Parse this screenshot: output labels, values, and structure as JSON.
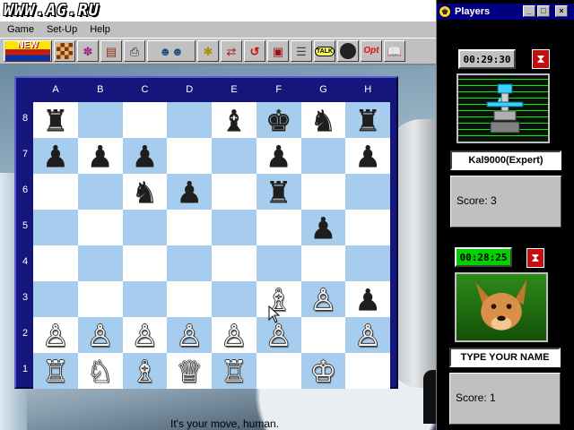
{
  "app": {
    "watermark": "WWW.AG.RU"
  },
  "menu": {
    "items": [
      "Game",
      "Set-Up",
      "Help"
    ]
  },
  "toolbar": {
    "new_label": "NEW",
    "talk_label": "TALK",
    "opt_label": "Opt",
    "buttons": [
      {
        "name": "new-game-button",
        "icon": "sunrise-icon"
      },
      {
        "name": "board-button",
        "icon": "board-icon"
      },
      {
        "name": "brain-button",
        "icon": "brain-icon"
      },
      {
        "name": "book-button",
        "icon": "book-icon"
      },
      {
        "name": "print-button",
        "icon": "printer-icon"
      },
      {
        "name": "players-button",
        "icon": "players-icon"
      },
      {
        "name": "hint-button",
        "icon": "lightbulb-icon"
      },
      {
        "name": "swap-button",
        "icon": "arrows-icon"
      },
      {
        "name": "undo-button",
        "icon": "undo-icon"
      },
      {
        "name": "windows-button",
        "icon": "windows-icon"
      },
      {
        "name": "notation-button",
        "icon": "notation-icon"
      },
      {
        "name": "talk-button",
        "icon": "talk-icon"
      },
      {
        "name": "sound-button",
        "icon": "speaker-icon"
      },
      {
        "name": "options-button",
        "icon": "options-icon"
      },
      {
        "name": "tutorial-button",
        "icon": "tutorial-book-icon"
      }
    ]
  },
  "board": {
    "files": [
      "A",
      "B",
      "C",
      "D",
      "E",
      "F",
      "G",
      "H"
    ],
    "ranks": [
      "8",
      "7",
      "6",
      "5",
      "4",
      "3",
      "2",
      "1"
    ],
    "pieces": {
      "a8": "♜",
      "e8": "♝",
      "f8": "♚",
      "g8": "♞",
      "h8": "♜",
      "a7": "♟",
      "b7": "♟",
      "c7": "♟",
      "f7": "♟",
      "h7": "♟",
      "c6": "♞",
      "d6": "♟",
      "f6": "♜",
      "g5": "♟",
      "f3": "♗",
      "g3": "♙",
      "h3": "♟",
      "a2": "♙",
      "b2": "♙",
      "c2": "♙",
      "d2": "♙",
      "e2": "♙",
      "f2": "♙",
      "h2": "♙",
      "a1": "♖",
      "b1": "♘",
      "c1": "♗",
      "d1": "♕",
      "e1": "♖",
      "g1": "♔"
    },
    "colors": {
      "light": "#ffffff",
      "dark": "#a6cdee",
      "frame": "#15167c"
    }
  },
  "status": {
    "message": "It's your move, human."
  },
  "players_window": {
    "title": "Players",
    "controls": {
      "minimize": "_",
      "maximize": "□",
      "close": "×"
    },
    "opponent": {
      "clock": "00:29:30",
      "name": "Kal9000(Expert)",
      "score": "Score: 3",
      "portrait": "robot-portrait"
    },
    "human": {
      "clock": "00:28:25",
      "name": "TYPE YOUR NAME",
      "score": "Score: 1",
      "portrait": "dog-portrait"
    },
    "colors": {
      "active_clock": "#00d000",
      "turn_indicator": "#c01010"
    }
  }
}
